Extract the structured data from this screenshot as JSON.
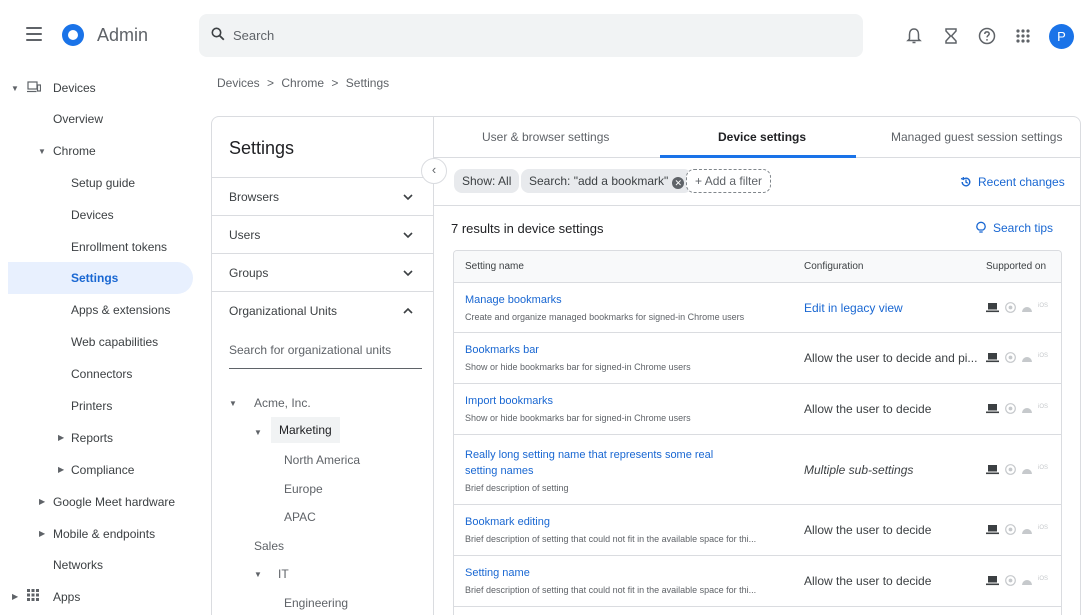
{
  "app": {
    "title": "Admin",
    "avatar_letter": "P",
    "brand_color": "#1a73e8"
  },
  "search": {
    "placeholder": "Search"
  },
  "top_icons": [
    "bell-icon",
    "hourglass-icon",
    "help-icon",
    "apps-grid-icon"
  ],
  "nav": {
    "items": [
      {
        "label": "Devices",
        "level": 0,
        "caret": "expanded",
        "icon": "devices-icon"
      },
      {
        "label": "Overview",
        "level": 1
      },
      {
        "label": "Chrome",
        "level": 1,
        "caret": "expanded"
      },
      {
        "label": "Setup guide",
        "level": 2
      },
      {
        "label": "Devices",
        "level": 2
      },
      {
        "label": "Enrollment tokens",
        "level": 2
      },
      {
        "label": "Settings",
        "level": 2,
        "selected": true
      },
      {
        "label": "Apps & extensions",
        "level": 2
      },
      {
        "label": "Web capabilities",
        "level": 2
      },
      {
        "label": "Connectors",
        "level": 2
      },
      {
        "label": "Printers",
        "level": 2
      },
      {
        "label": "Reports",
        "level": 2,
        "caret": "collapsed"
      },
      {
        "label": "Compliance",
        "level": 2,
        "caret": "collapsed"
      },
      {
        "label": "Google Meet hardware",
        "level": 1,
        "caret": "collapsed"
      },
      {
        "label": "Mobile & endpoints",
        "level": 1,
        "caret": "collapsed"
      },
      {
        "label": "Networks",
        "level": 1
      },
      {
        "label": "Apps",
        "level": 0,
        "caret": "collapsed",
        "icon": "apps-icon"
      }
    ]
  },
  "breadcrumb": [
    "Devices",
    ">",
    "Chrome",
    ">",
    "Settings"
  ],
  "settings_panel": {
    "title": "Settings",
    "sections": [
      {
        "label": "Browsers",
        "state": "collapsed"
      },
      {
        "label": "Users",
        "state": "collapsed"
      },
      {
        "label": "Groups",
        "state": "collapsed"
      },
      {
        "label": "Organizational Units",
        "state": "expanded"
      }
    ],
    "ou_search_placeholder": "Search for organizational units",
    "ou_tree": [
      {
        "label": "Acme, Inc.",
        "caret": "expanded"
      },
      {
        "label": "Marketing",
        "caret": "expanded",
        "selected": true
      },
      {
        "label": "North America"
      },
      {
        "label": "Europe"
      },
      {
        "label": "APAC"
      },
      {
        "label": "Sales"
      },
      {
        "label": "IT",
        "caret": "expanded"
      },
      {
        "label": "Engineering"
      }
    ]
  },
  "tabs": [
    {
      "label": "User & browser settings",
      "active": false
    },
    {
      "label": "Device settings",
      "active": true
    },
    {
      "label": "Managed guest session settings",
      "active": false
    }
  ],
  "filters": {
    "chips": [
      "Show: All",
      "Search: \"add a bookmark\""
    ],
    "add_filter": "Add a filter",
    "recent_changes": "Recent changes"
  },
  "results": {
    "count_text": "7 results in device settings",
    "search_tips": "Search tips"
  },
  "table": {
    "columns": [
      "Setting name",
      "Configuration",
      "Supported on"
    ],
    "rows": [
      {
        "name": "Manage bookmarks",
        "desc": "Create and organize managed bookmarks for signed-in Chrome users",
        "config": "Edit in legacy view",
        "config_style": "link"
      },
      {
        "name": "Bookmarks bar",
        "desc": "Show or hide bookmarks bar for signed-in Chrome users",
        "config": "Allow the user to decide and pi...",
        "config_style": "normal"
      },
      {
        "name": "Import bookmarks",
        "desc": "Show or hide bookmarks bar for signed-in Chrome users",
        "config": "Allow the user to decide",
        "config_style": "normal"
      },
      {
        "name": "Really long setting name that represents some real setting names",
        "desc": "Brief description of setting",
        "config": "Multiple sub-settings",
        "config_style": "italic"
      },
      {
        "name": "Bookmark editing",
        "desc": "Brief description of setting that could not fit in the available space for thi...",
        "config": "Allow the user to decide",
        "config_style": "normal"
      },
      {
        "name": "Setting name",
        "desc": "Brief description of setting that could not fit in the available space for thi...",
        "config": "Allow the user to decide",
        "config_style": "normal"
      }
    ],
    "platform_icons": [
      "laptop-icon",
      "chrome-icon",
      "android-icon",
      "ios-icon"
    ],
    "ios_label": "iOS"
  }
}
